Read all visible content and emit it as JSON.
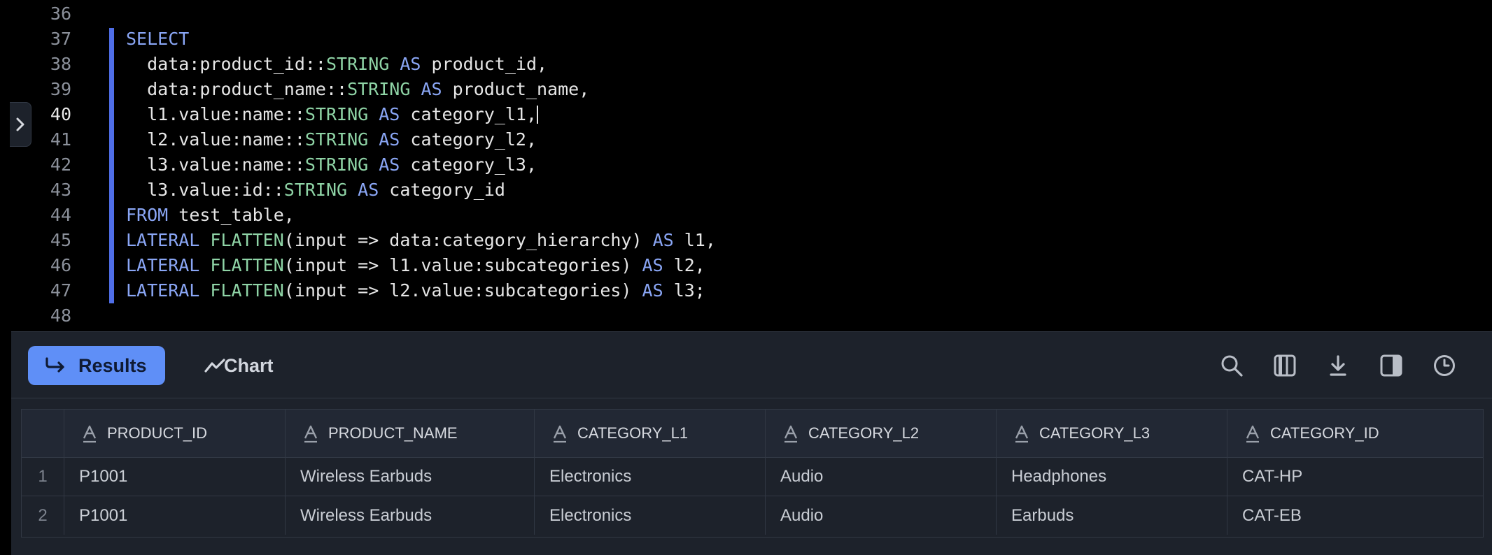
{
  "editor": {
    "lines": [
      {
        "number": "36",
        "tokens": []
      },
      {
        "number": "37",
        "tokens": [
          {
            "t": "SELECT",
            "c": "kw"
          }
        ]
      },
      {
        "number": "38",
        "tokens": [
          {
            "t": "  data:product_id::",
            "c": "plain"
          },
          {
            "t": "STRING",
            "c": "ty"
          },
          {
            "t": " AS",
            "c": "kw"
          },
          {
            "t": " product_id,",
            "c": "plain"
          }
        ]
      },
      {
        "number": "39",
        "tokens": [
          {
            "t": "  data:product_name::",
            "c": "plain"
          },
          {
            "t": "STRING",
            "c": "ty"
          },
          {
            "t": " AS",
            "c": "kw"
          },
          {
            "t": " product_name,",
            "c": "plain"
          }
        ]
      },
      {
        "number": "40",
        "tokens": [
          {
            "t": "  l1.value:name::",
            "c": "plain"
          },
          {
            "t": "STRING",
            "c": "ty"
          },
          {
            "t": " AS",
            "c": "kw"
          },
          {
            "t": " category_l1,",
            "c": "plain"
          }
        ],
        "active": true
      },
      {
        "number": "41",
        "tokens": [
          {
            "t": "  l2.value:name::",
            "c": "plain"
          },
          {
            "t": "STRING",
            "c": "ty"
          },
          {
            "t": " AS",
            "c": "kw"
          },
          {
            "t": " category_l2,",
            "c": "plain"
          }
        ]
      },
      {
        "number": "42",
        "tokens": [
          {
            "t": "  l3.value:name::",
            "c": "plain"
          },
          {
            "t": "STRING",
            "c": "ty"
          },
          {
            "t": " AS",
            "c": "kw"
          },
          {
            "t": " category_l3,",
            "c": "plain"
          }
        ]
      },
      {
        "number": "43",
        "tokens": [
          {
            "t": "  l3.value:id::",
            "c": "plain"
          },
          {
            "t": "STRING",
            "c": "ty"
          },
          {
            "t": " AS",
            "c": "kw"
          },
          {
            "t": " category_id",
            "c": "plain"
          }
        ]
      },
      {
        "number": "44",
        "tokens": [
          {
            "t": "FROM",
            "c": "kw"
          },
          {
            "t": " test_table,",
            "c": "plain"
          }
        ]
      },
      {
        "number": "45",
        "tokens": [
          {
            "t": "LATERAL",
            "c": "kw"
          },
          {
            "t": " FLATTEN",
            "c": "fn"
          },
          {
            "t": "(input => data:category_hierarchy)",
            "c": "plain"
          },
          {
            "t": " AS",
            "c": "kw"
          },
          {
            "t": " l1,",
            "c": "plain"
          }
        ]
      },
      {
        "number": "46",
        "tokens": [
          {
            "t": "LATERAL",
            "c": "kw"
          },
          {
            "t": " FLATTEN",
            "c": "fn"
          },
          {
            "t": "(input => l1.value:subcategories)",
            "c": "plain"
          },
          {
            "t": " AS",
            "c": "kw"
          },
          {
            "t": " l2,",
            "c": "plain"
          }
        ]
      },
      {
        "number": "47",
        "tokens": [
          {
            "t": "LATERAL",
            "c": "kw"
          },
          {
            "t": " FLATTEN",
            "c": "fn"
          },
          {
            "t": "(input => l2.value:subcategories)",
            "c": "plain"
          },
          {
            "t": " AS",
            "c": "kw"
          },
          {
            "t": " l3;",
            "c": "plain"
          }
        ]
      },
      {
        "number": "48",
        "tokens": []
      }
    ]
  },
  "results_panel": {
    "tabs": [
      {
        "label": "Results",
        "icon": "return-arrow-icon",
        "active": true
      },
      {
        "label": "Chart",
        "icon": "line-chart-icon",
        "active": false
      }
    ],
    "tools": [
      "search-icon",
      "columns-icon",
      "download-icon",
      "sidebar-panel-icon",
      "history-clock-icon"
    ]
  },
  "table": {
    "columns": [
      "PRODUCT_ID",
      "PRODUCT_NAME",
      "CATEGORY_L1",
      "CATEGORY_L2",
      "CATEGORY_L3",
      "CATEGORY_ID"
    ],
    "column_type_icon": "text-type-icon",
    "rows": [
      {
        "index": "1",
        "cells": [
          "P1001",
          "Wireless Earbuds",
          "Electronics",
          "Audio",
          "Headphones",
          "CAT-HP"
        ]
      },
      {
        "index": "2",
        "cells": [
          "P1001",
          "Wireless Earbuds",
          "Electronics",
          "Audio",
          "Earbuds",
          "CAT-EB"
        ]
      }
    ]
  },
  "colors": {
    "accent": "#5f8ff7",
    "keyword": "#8aa6f5",
    "type": "#8fd4a6",
    "gutter_bar": "#4f6ee8"
  }
}
